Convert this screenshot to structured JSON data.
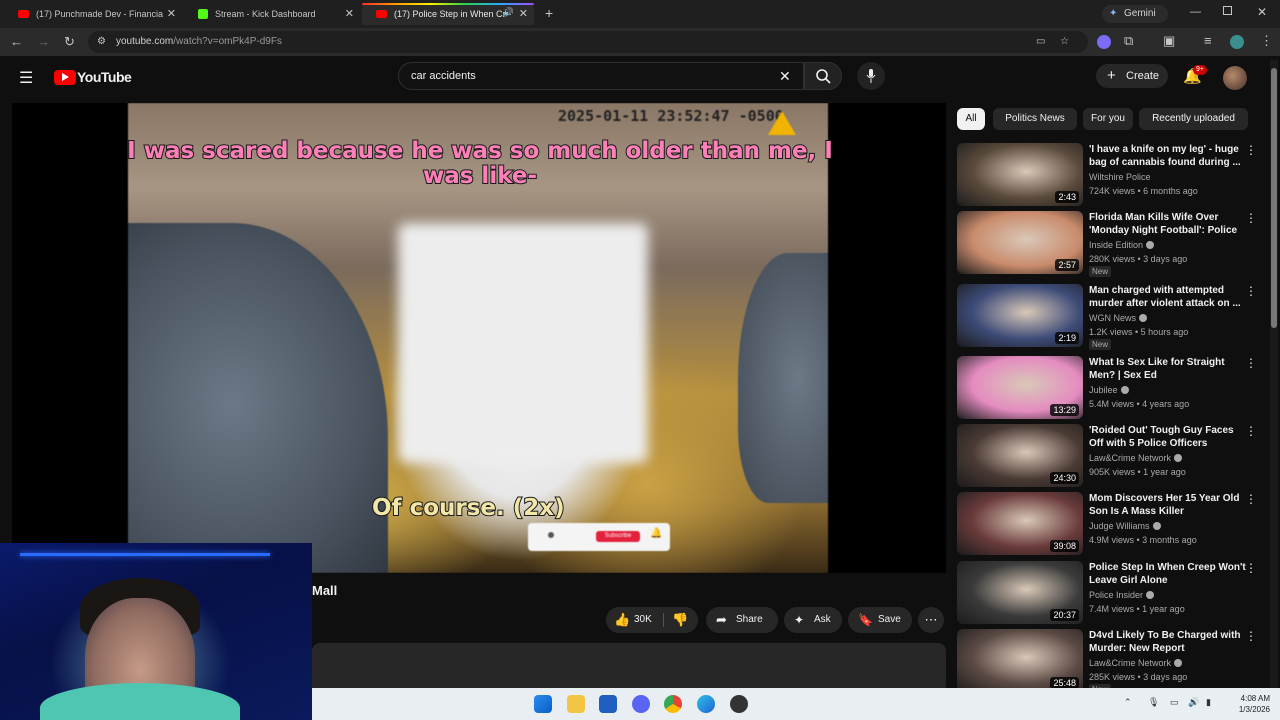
{
  "browser": {
    "tabs": [
      {
        "label": "(17) Punchmade Dev - Financia",
        "fav": "#ff0000"
      },
      {
        "label": "Stream - Kick Dashboard",
        "fav": "#53fc18"
      },
      {
        "label": "(17) Police Step in When Cr",
        "fav": "#ff0000"
      }
    ],
    "gemini_label": "Gemini",
    "url_host": "youtube.com",
    "url_path": "/watch?v=omPk4P-d9Fs"
  },
  "youtube": {
    "logo_text": "YouTube",
    "search_value": "car accidents",
    "create_label": "Create",
    "notif_badge": "9+"
  },
  "video": {
    "timestamp": "2025-01-11  23:52:47 -0500",
    "caption_top": "I was scared because he was so much older than me, I was like-",
    "caption_bottom": "Of course. (2x)",
    "subscribe_label": "Subscribe",
    "title_tail": "Mall",
    "likes": "30K",
    "share_label": "Share",
    "ask_label": "Ask",
    "save_label": "Save"
  },
  "chips": [
    "All",
    "Politics News",
    "For you",
    "Recently uploaded"
  ],
  "recommendations": [
    {
      "title": "'I have a knife on my leg' - huge bag of cannabis found during ...",
      "channel": "Wiltshire Police",
      "verified": false,
      "meta": "724K views • 6 months ago",
      "duration": "2:43",
      "new": "",
      "thumb": "#5a4a3c"
    },
    {
      "title": "Florida Man Kills Wife Over 'Monday Night Football': Police",
      "channel": "Inside Edition",
      "verified": true,
      "meta": "280K views • 3 days ago",
      "duration": "2:57",
      "new": "New",
      "thumb": "#c98b6c"
    },
    {
      "title": "Man charged with attempted murder after violent attack on ...",
      "channel": "WGN News",
      "verified": true,
      "meta": "1.2K views • 5 hours ago",
      "duration": "2:19",
      "new": "New",
      "thumb": "#3d4b78"
    },
    {
      "title": "What Is Sex Like for Straight Men? | Sex Ed",
      "channel": "Jubilee",
      "verified": true,
      "meta": "5.4M views • 4 years ago",
      "duration": "13:29",
      "new": "",
      "thumb": "#e48cc0"
    },
    {
      "title": "'Roided Out' Tough Guy Faces Off with 5 Police Officers",
      "channel": "Law&Crime Network",
      "verified": true,
      "meta": "905K views • 1 year ago",
      "duration": "24:30",
      "new": "",
      "thumb": "#4a3a34"
    },
    {
      "title": "Mom Discovers Her 15 Year Old Son Is A Mass Killer",
      "channel": "Judge Williams",
      "verified": true,
      "meta": "4.9M views • 3 months ago",
      "duration": "39:08",
      "new": "",
      "thumb": "#6a3b3b"
    },
    {
      "title": "Police Step In When Creep Won't Leave Girl Alone",
      "channel": "Police Insider",
      "verified": true,
      "meta": "7.4M views • 1 year ago",
      "duration": "20:37",
      "new": "",
      "thumb": "#3a3a3a"
    },
    {
      "title": "D4vd Likely To Be Charged with Murder: New Report",
      "channel": "Law&Crime Network",
      "verified": true,
      "meta": "285K views • 3 days ago",
      "duration": "25:48",
      "new": "New",
      "thumb": "#5b4a44"
    }
  ],
  "taskbar": {
    "time": "4:08 AM",
    "date": "1/3/2026"
  },
  "colors": {
    "yt_red": "#ff0000",
    "accent_blue": "#3ea6ff"
  }
}
